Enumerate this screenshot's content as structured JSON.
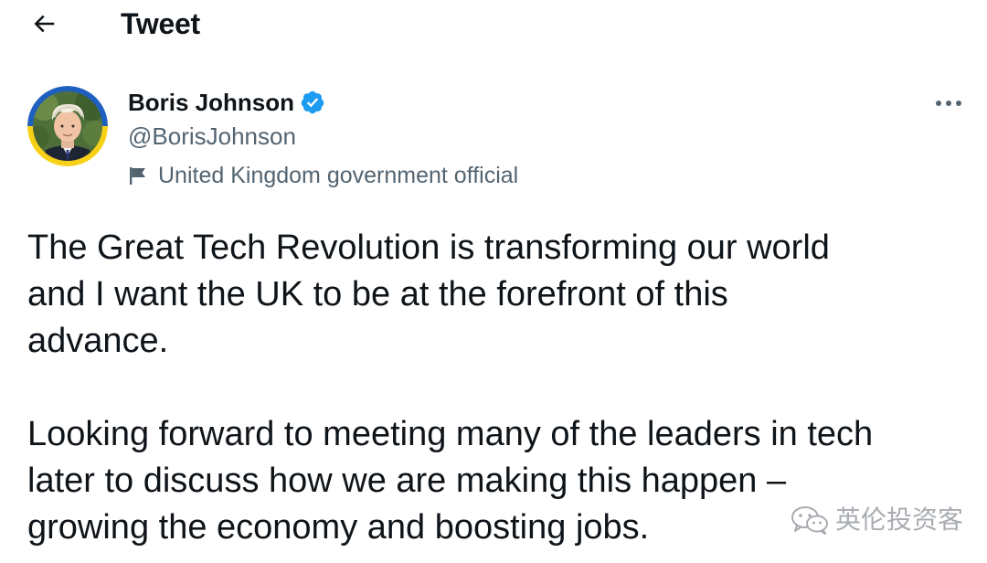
{
  "header": {
    "back_icon": "arrow-left-icon",
    "title": "Tweet"
  },
  "author": {
    "avatar_icon": "profile-photo",
    "name": "Boris Johnson",
    "verified_icon": "verified-badge-icon",
    "verified_color": "#1d9bf0",
    "handle": "@BorisJohnson",
    "label_icon": "flag-icon",
    "label": "United Kingdom government official"
  },
  "more_icon": "more-options-icon",
  "tweet": {
    "paragraphs": [
      "The Great Tech Revolution is transforming our world\nand I want the UK to be at the forefront of this\nadvance.",
      "Looking forward to meeting many of the leaders in tech\nlater to discuss how we are making this happen –\ngrowing the economy and boosting jobs."
    ]
  },
  "watermark": {
    "icon": "wechat-icon",
    "text": "英伦投资客"
  },
  "colors": {
    "text": "#0f1419",
    "secondary": "#536471",
    "verified": "#1d9bf0",
    "avatar_ring_yellow": "#f7d117",
    "avatar_ring_blue": "#1f5fbf"
  }
}
